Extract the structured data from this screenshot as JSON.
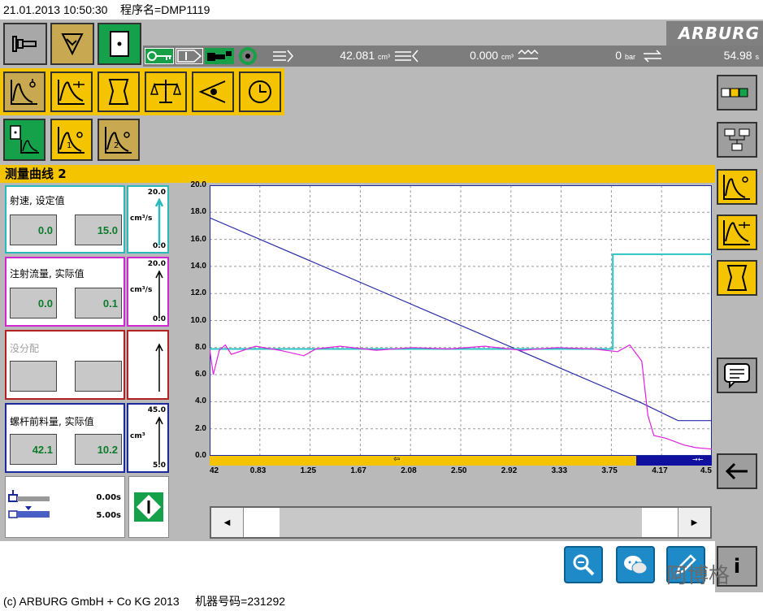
{
  "header": {
    "datetime": "21.01.2013 10:50:30",
    "program": "程序名=DMP1119"
  },
  "brand": "ARBURG",
  "status": {
    "volume": "42.081",
    "volume_unit": "cm³",
    "volume2": "0.000",
    "volume2_unit": "cm³",
    "pressure": "0",
    "pressure_unit": "bar",
    "cycle": "54.98",
    "cycle_unit": "s"
  },
  "page_title": "测量曲线 2",
  "panels": [
    {
      "label": "射速, 设定值",
      "v1": "0.0",
      "v2": "15.0",
      "smax": "20.0",
      "smin": "0.0",
      "unit": "cm³/s",
      "color": "#2bb8b8"
    },
    {
      "label": "注射流量, 实际值",
      "v1": "0.0",
      "v2": "0.1",
      "smax": "20.0",
      "smin": "0.0",
      "unit": "cm³/s",
      "color": "#d028d0"
    },
    {
      "label": "没分配",
      "v1": "",
      "v2": "",
      "smax": "",
      "smin": "",
      "unit": "",
      "color": "#b22222"
    },
    {
      "label": "螺杆前料量, 实际值",
      "v1": "42.1",
      "v2": "10.2",
      "smax": "45.0",
      "smin": "5.0",
      "unit": "cm³",
      "color": "#1a2a9a"
    }
  ],
  "timer": {
    "t1": "0.00s",
    "t2": "5.00s"
  },
  "chart_data": {
    "type": "line",
    "ylim": [
      0.0,
      20.0
    ],
    "yticks": [
      "20.0",
      "18.0",
      "16.0",
      "14.0",
      "12.0",
      "10.0",
      "8.0",
      "6.0",
      "4.0",
      "2.0",
      "0.0"
    ],
    "xlim": [
      0.42,
      4.58
    ],
    "xticks": [
      "42",
      "0.83",
      "1.25",
      "1.67",
      "2.08",
      "2.50",
      "2.92",
      "3.33",
      "3.75",
      "4.17",
      "4.5"
    ],
    "series": [
      {
        "color": "#2a2aa8",
        "x": [
          0.42,
          4.0,
          4.3,
          4.58
        ],
        "y": [
          17.6,
          3.9,
          2.6,
          2.6
        ]
      },
      {
        "color": "#2bc4c4",
        "x": [
          0.42,
          3.76,
          3.76,
          4.58
        ],
        "y": [
          7.9,
          7.9,
          14.9,
          14.9
        ]
      },
      {
        "color": "#e020e0",
        "x": [
          0.42,
          0.45,
          0.5,
          0.55,
          0.6,
          0.8,
          1.0,
          1.2,
          1.3,
          1.5,
          1.8,
          2.1,
          2.4,
          2.7,
          3.0,
          3.3,
          3.6,
          3.8,
          3.9,
          3.95,
          4.0,
          4.05,
          4.1,
          4.2,
          4.35,
          4.45,
          4.58
        ],
        "y": [
          7.9,
          6.0,
          7.8,
          8.2,
          7.5,
          8.1,
          7.8,
          7.4,
          7.9,
          8.1,
          7.8,
          8.0,
          7.9,
          8.1,
          7.8,
          8.0,
          7.9,
          7.7,
          8.2,
          7.6,
          7.0,
          3.0,
          1.5,
          1.3,
          0.8,
          0.6,
          0.5
        ]
      }
    ]
  },
  "footer": {
    "copyright": "(c) ARBURG GmbH + Co KG 2013",
    "machine": "机器号码=231292"
  },
  "watermark": "阿博格"
}
